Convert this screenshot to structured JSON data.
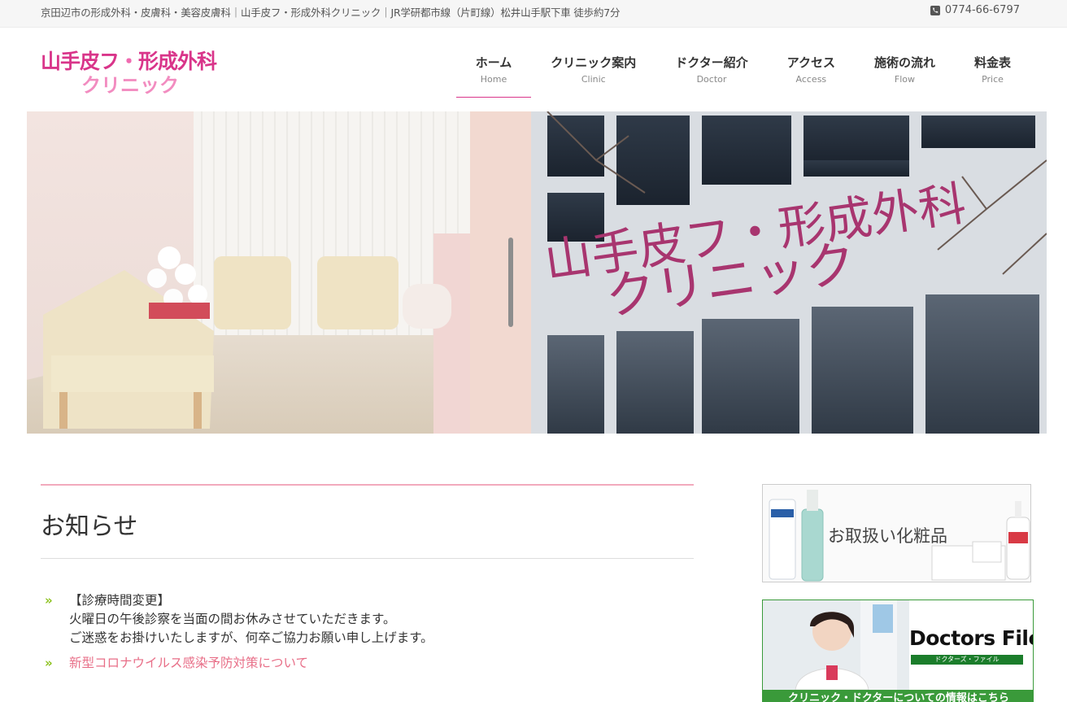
{
  "topbar": {
    "tagline": "京田辺市の形成外科・皮膚科・美容皮膚科｜山手皮フ・形成外科クリニック｜JR学研都市線（片町線）松井山手駅下車 徒歩約7分",
    "phone": "0774-66-6797",
    "phone_icon": "phone-icon"
  },
  "logo": {
    "line1_a": "山手皮フ",
    "line1_dot": "・",
    "line1_b": "形成外科",
    "line2": "クリニック"
  },
  "nav": {
    "items": [
      {
        "jp": "ホーム",
        "en": "Home"
      },
      {
        "jp": "クリニック案内",
        "en": "Clinic"
      },
      {
        "jp": "ドクター紹介",
        "en": "Doctor"
      },
      {
        "jp": "アクセス",
        "en": "Access"
      },
      {
        "jp": "施術の流れ",
        "en": "Flow"
      },
      {
        "jp": "料金表",
        "en": "Price"
      }
    ],
    "active": "ホーム"
  },
  "hero": {
    "sign_line1": "山手皮フ・形成外科",
    "sign_line2": "クリニック"
  },
  "notice": {
    "title": "お知らせ",
    "items": [
      {
        "line1": "【診療時間変更】",
        "line2": "火曜日の午後診察を当面の間お休みさせていただきます。",
        "line3": "ご迷惑をお掛けいたしますが、何卒ご協力お願い申し上げます。"
      },
      {
        "link": "新型コロナウイルス感染予防対策について"
      }
    ],
    "bullet": "»"
  },
  "sidebar": {
    "cosmetics_banner": "お取扱い化粧品",
    "doctors_file_title": "Doctors File",
    "doctors_file_sub": "ドクターズ・ファイル",
    "doctors_file_bar": "クリニック・ドクターについての情報はこちら"
  },
  "colors": {
    "brand_pink": "#d9358a",
    "light_pink": "#f28cc0",
    "link_pink": "#e86f88",
    "bullet_green": "#8dc21f",
    "doctors_green": "#3a9a3a"
  }
}
